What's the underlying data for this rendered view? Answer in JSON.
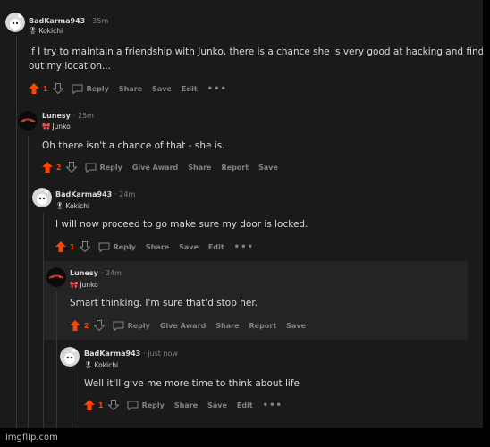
{
  "comments": [
    {
      "username": "BadKarma943",
      "time": "· 35m",
      "flair": "Kokichi",
      "body_lines": [
        "If I try to maintain a friendship with Junko, there is a chance she is very good at hacking and finding",
        "out my location..."
      ],
      "votes": "1",
      "actions": [
        "Reply",
        "Share",
        "Save",
        "Edit"
      ]
    },
    {
      "username": "Lunesy",
      "time": "· 25m",
      "flair": "Junko",
      "body_lines": [
        "Oh there isn't a chance of that - she is."
      ],
      "votes": "2",
      "actions": [
        "Reply",
        "Give Award",
        "Share",
        "Report",
        "Save"
      ]
    },
    {
      "username": "BadKarma943",
      "time": "· 24m",
      "flair": "Kokichi",
      "body_lines": [
        "I will now proceed to go make sure my door is locked."
      ],
      "votes": "1",
      "actions": [
        "Reply",
        "Share",
        "Save",
        "Edit"
      ]
    },
    {
      "username": "Lunesy",
      "time": "· 24m",
      "flair": "Junko",
      "body_lines": [
        "Smart thinking. I'm sure that'd stop her."
      ],
      "votes": "2",
      "actions": [
        "Reply",
        "Give Award",
        "Share",
        "Report",
        "Save"
      ]
    },
    {
      "username": "BadKarma943",
      "time": "· just now",
      "flair": "Kokichi",
      "body_lines": [
        "Well it'll give me more time to think about life"
      ],
      "votes": "1",
      "actions": [
        "Reply",
        "Share",
        "Save",
        "Edit"
      ]
    }
  ],
  "more_label": "•••",
  "footer": "imgflip.com",
  "colors": {
    "background": "#1a1a1b",
    "highlight": "#242425",
    "upvote": "#ff4500",
    "muted": "#818384"
  }
}
